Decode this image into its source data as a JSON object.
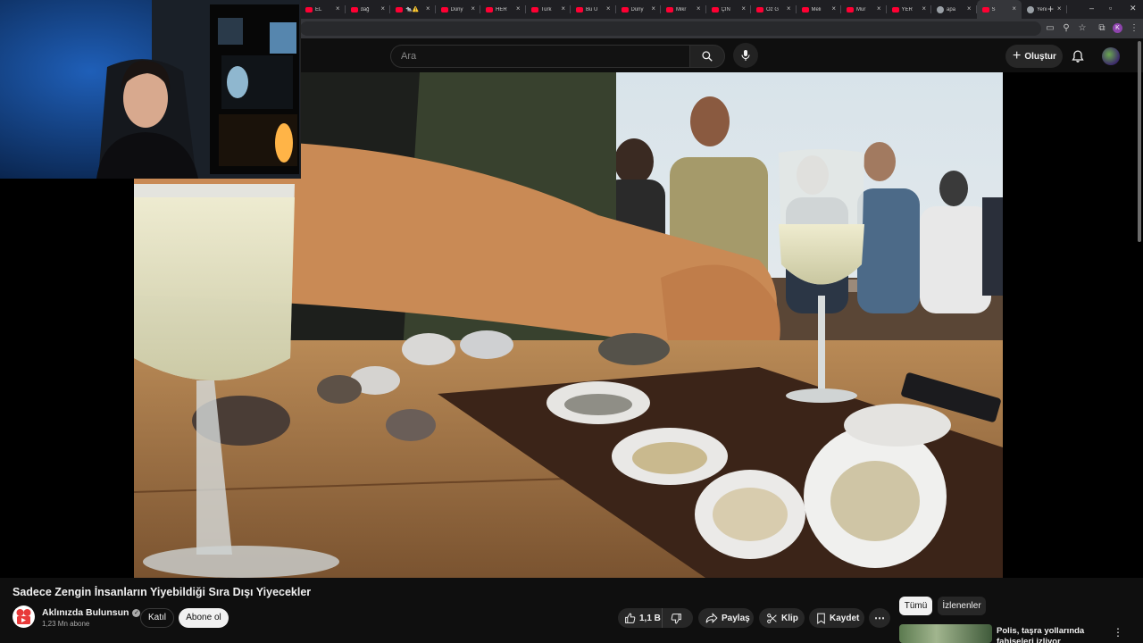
{
  "browser": {
    "tabs": [
      {
        "title": "EL",
        "icon": "youtube-icon"
      },
      {
        "title": "dağ",
        "icon": "youtube-icon"
      },
      {
        "title": "🐀⚠️",
        "icon": "youtube-icon"
      },
      {
        "title": "Düny",
        "icon": "youtube-icon"
      },
      {
        "title": "HER",
        "icon": "youtube-icon"
      },
      {
        "title": "Türk",
        "icon": "youtube-icon"
      },
      {
        "title": "Bu Ü",
        "icon": "youtube-icon"
      },
      {
        "title": "Düny",
        "icon": "youtube-icon"
      },
      {
        "title": "Mikr",
        "icon": "youtube-icon"
      },
      {
        "title": "ÇİN",
        "icon": "youtube-icon"
      },
      {
        "title": "Öz G",
        "icon": "youtube-icon"
      },
      {
        "title": "Meli",
        "icon": "youtube-icon"
      },
      {
        "title": "Mur",
        "icon": "youtube-icon"
      },
      {
        "title": "YER",
        "icon": "youtube-icon"
      },
      {
        "title": "apa",
        "icon": "globe-icon"
      },
      {
        "title": "S",
        "icon": "youtube-icon",
        "active": true
      },
      {
        "title": "Yeni",
        "icon": "globe-icon"
      }
    ],
    "profile_initial": "K"
  },
  "masthead": {
    "search_placeholder": "Ara",
    "create_label": "Oluştur"
  },
  "video": {
    "title": "Sadece Zengin İnsanların Yiyebildiği Sıra Dışı Yiyecekler",
    "channel_name": "Aklınızda Bulunsun",
    "subscribers": "1,23 Mn abone",
    "join_label": "Katıl",
    "subscribe_label": "Abone ol",
    "like_count": "1,1 B",
    "share_label": "Paylaş",
    "clip_label": "Klip",
    "save_label": "Kaydet"
  },
  "sidebar": {
    "chips": [
      "Tümü",
      "İzlenenler"
    ],
    "recommendation": {
      "title": "Polis, taşra yollarında fahişeleri izliyor"
    }
  },
  "colors": {
    "background": "#0f0f0f",
    "youtube_red": "#ff0033",
    "chip_active": "#f1f1f1",
    "button_bg": "#272727"
  }
}
